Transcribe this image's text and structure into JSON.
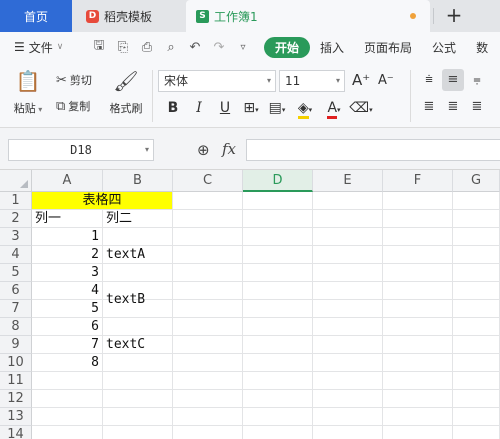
{
  "tabs": {
    "home": "首页",
    "template": "稻壳模板",
    "template_logo": "D",
    "document": "工作簿1",
    "document_logo": "S",
    "add_icon": "+"
  },
  "menu": {
    "file": "文件",
    "tabs": [
      "开始",
      "插入",
      "页面布局",
      "公式",
      "数"
    ],
    "active_tab": "开始"
  },
  "ribbon": {
    "paste": "粘贴",
    "cut": "剪切",
    "copy": "复制",
    "format_painter": "格式刷",
    "font_name": "宋体",
    "font_size": "11",
    "grow_font": "A⁺",
    "shrink_font": "A⁻",
    "bold": "B",
    "italic": "I",
    "underline": "U",
    "font_color_glyph": "A"
  },
  "formula_bar": {
    "name_box": "D18",
    "fx": "fx",
    "formula": ""
  },
  "sheet": {
    "columns": [
      "A",
      "B",
      "C",
      "D",
      "E",
      "F",
      "G"
    ],
    "selected_column": "D",
    "rows": [
      "1",
      "2",
      "3",
      "4",
      "5",
      "6",
      "7",
      "8",
      "9",
      "10",
      "11",
      "12",
      "13",
      "14"
    ],
    "title_cell": "表格四",
    "header_a": "列一",
    "header_b": "列二",
    "numbers": [
      "1",
      "2",
      "3",
      "4",
      "5",
      "6",
      "7",
      "8"
    ],
    "texts": [
      "textA",
      "textB",
      "textC"
    ],
    "title_fill_color": "#ffff00",
    "accent_color": "#2a9a5a"
  }
}
